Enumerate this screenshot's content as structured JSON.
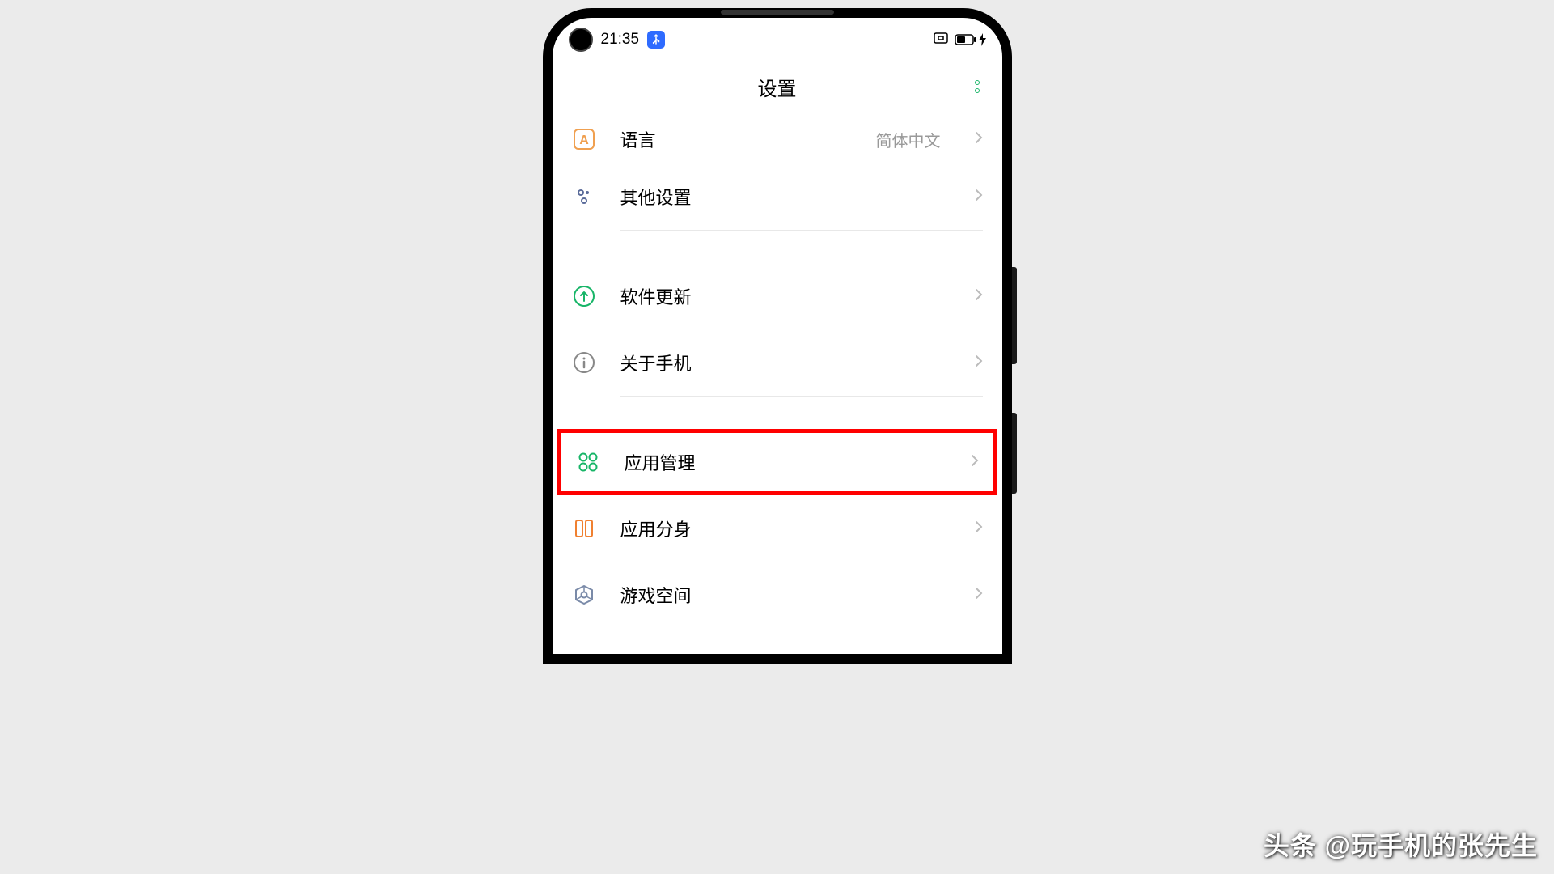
{
  "status": {
    "time": "21:35"
  },
  "header": {
    "title": "设置"
  },
  "items": {
    "language": {
      "label": "语言",
      "value": "简体中文"
    },
    "other": {
      "label": "其他设置"
    },
    "update": {
      "label": "软件更新"
    },
    "about": {
      "label": "关于手机"
    },
    "appmgmt": {
      "label": "应用管理"
    },
    "appclone": {
      "label": "应用分身"
    },
    "gamespace": {
      "label": "游戏空间"
    }
  },
  "watermark": "头条 @玩手机的张先生"
}
